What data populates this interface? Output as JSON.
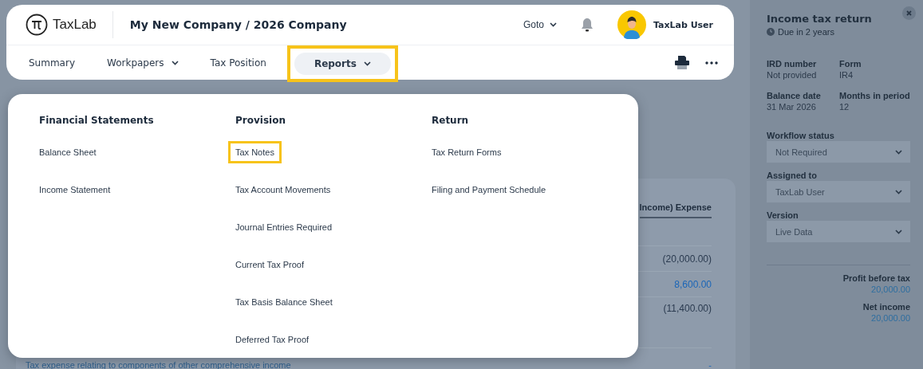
{
  "header": {
    "logo_text": "TaxLab",
    "title": "My New Company / 2026 Company",
    "goto": "Goto",
    "user": "TaxLab User"
  },
  "tabs": [
    {
      "label": "Summary",
      "selected": false,
      "dropdown": false,
      "highlighted": false
    },
    {
      "label": "Workpapers",
      "selected": false,
      "dropdown": true,
      "highlighted": false
    },
    {
      "label": "Tax Position",
      "selected": false,
      "dropdown": false,
      "highlighted": false
    },
    {
      "label": "Reports",
      "selected": true,
      "dropdown": true,
      "highlighted": true
    }
  ],
  "menu": {
    "columns": [
      {
        "heading": "Financial Statements",
        "items": [
          {
            "label": "Balance Sheet",
            "highlighted": false
          },
          {
            "label": "Income Statement",
            "highlighted": false
          }
        ]
      },
      {
        "heading": "Provision",
        "items": [
          {
            "label": "Tax Notes",
            "highlighted": true
          },
          {
            "label": "Tax Account Movements",
            "highlighted": false
          },
          {
            "label": "Journal Entries Required",
            "highlighted": false
          },
          {
            "label": "Current Tax Proof",
            "highlighted": false
          },
          {
            "label": "Tax Basis Balance Sheet",
            "highlighted": false
          },
          {
            "label": "Deferred Tax Proof",
            "highlighted": false
          }
        ]
      },
      {
        "heading": "Return",
        "items": [
          {
            "label": "Tax Return Forms",
            "highlighted": false
          },
          {
            "label": "Filing and Payment Schedule",
            "highlighted": false
          }
        ]
      }
    ]
  },
  "table": {
    "column_header": "Income) Expense",
    "rows": [
      {
        "label": "",
        "value": "(20,000.00)",
        "link": false
      },
      {
        "label": "",
        "value": "8,600.00",
        "link": true
      },
      {
        "label": "",
        "value": "(11,400.00)",
        "link": false
      },
      {
        "label": "Tax expense relating to components of other comprehensive income",
        "value": "-",
        "link": true
      }
    ]
  },
  "panel": {
    "title": "Income tax return",
    "due": "Due in 2 years",
    "facts": [
      {
        "label": "IRD number",
        "value": "Not provided"
      },
      {
        "label": "Form",
        "value": "IR4"
      },
      {
        "label": "Balance date",
        "value": "31 Mar 2026"
      },
      {
        "label": "Months in period",
        "value": "12"
      }
    ],
    "selects": [
      {
        "label": "Workflow status",
        "value": "Not Required"
      },
      {
        "label": "Assigned to",
        "value": "TaxLab User"
      },
      {
        "label": "Version",
        "value": "Live Data"
      }
    ],
    "totals": [
      {
        "label": "Profit before tax",
        "value": "20,000.00"
      },
      {
        "label": "Net income",
        "value": "20,000.00"
      }
    ]
  }
}
